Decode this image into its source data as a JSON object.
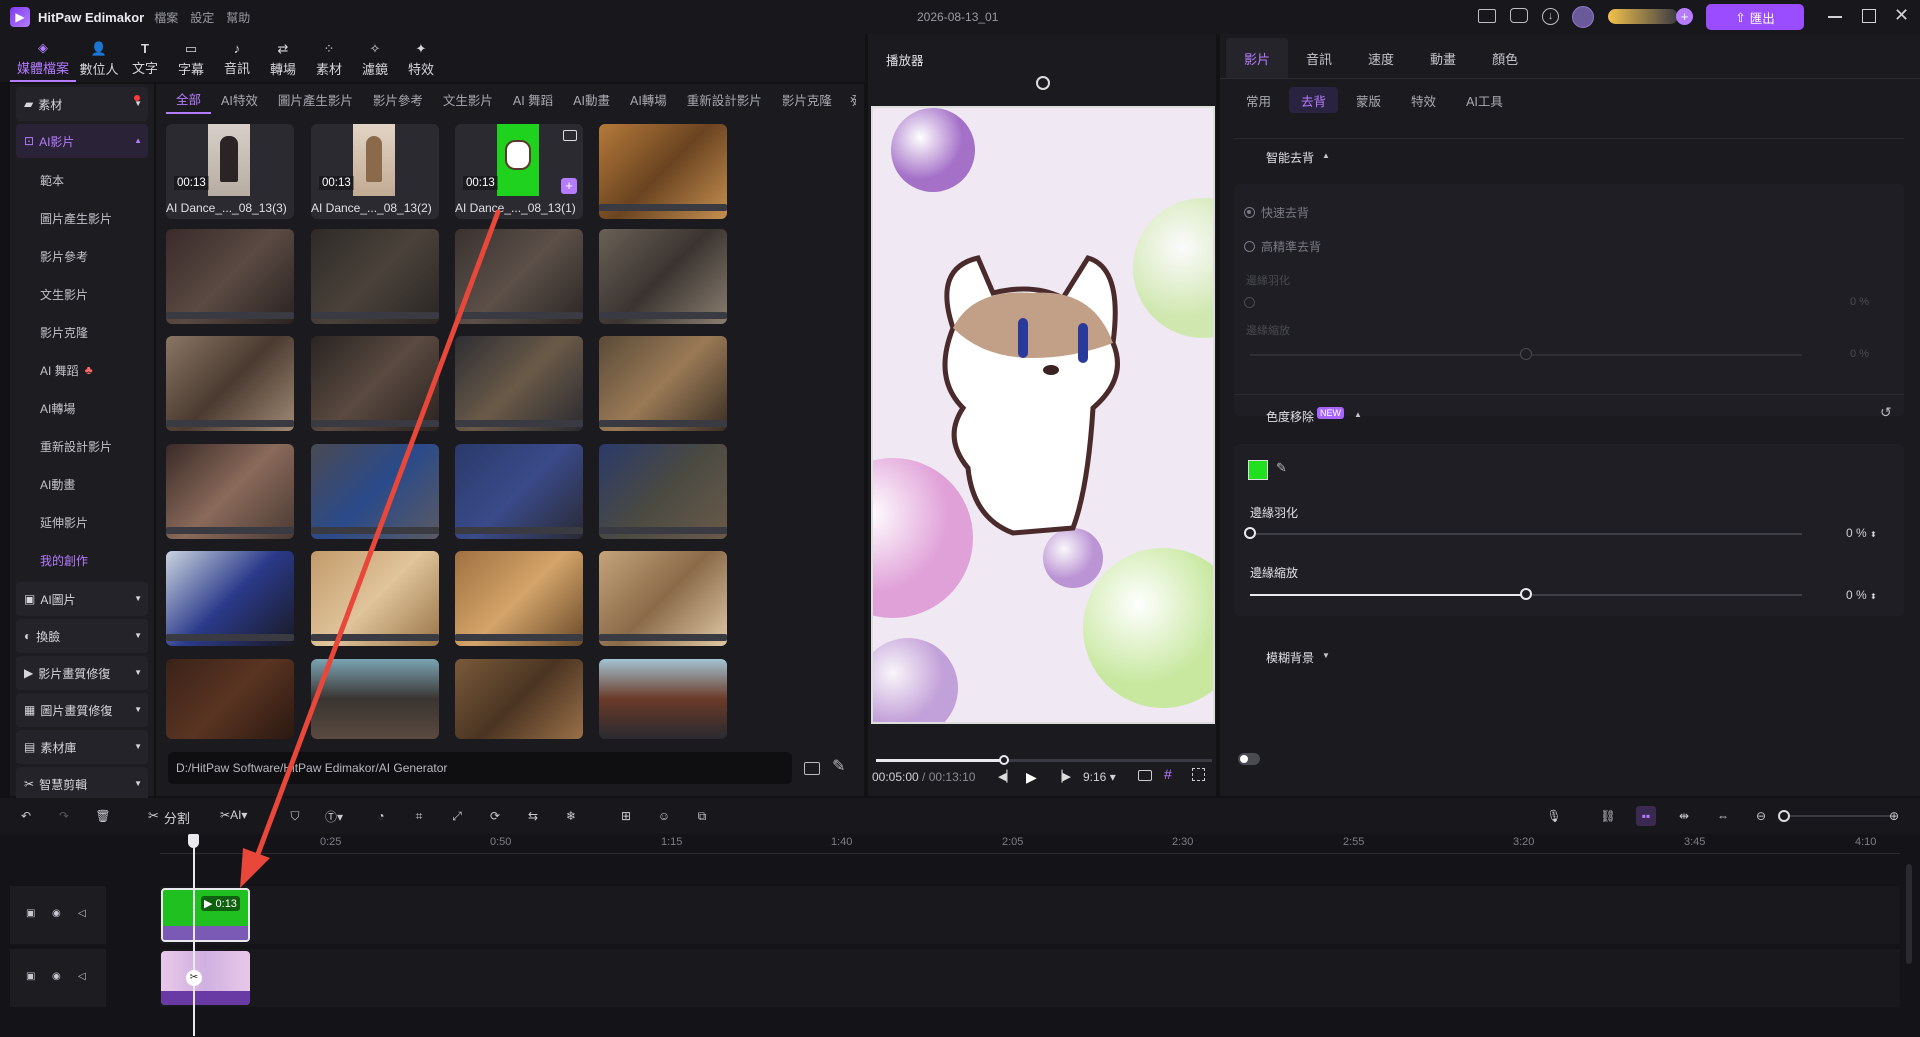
{
  "app": {
    "name": "HitPaw Edimakor",
    "menu": [
      "檔案",
      "設定",
      "幫助"
    ],
    "project_title": "2026-08-13_01",
    "export_label": "匯出"
  },
  "toolbar": {
    "tools": [
      "媒體檔案",
      "數位人",
      "文字",
      "字幕",
      "音訊",
      "轉場",
      "素材",
      "濾鏡",
      "特效"
    ]
  },
  "sidebar": {
    "sections": [
      {
        "label": "素材"
      },
      {
        "label": "AI影片",
        "items": [
          "範本",
          "圖片產生影片",
          "影片參考",
          "文生影片",
          "影片克隆",
          "AI 舞蹈",
          "AI轉場",
          "重新設計影片",
          "AI動畫",
          "延伸影片",
          "我的創作"
        ]
      },
      {
        "label": "AI圖片"
      },
      {
        "label": "換臉"
      },
      {
        "label": "影片畫質修復"
      },
      {
        "label": "圖片畫質修復"
      },
      {
        "label": "素材庫"
      },
      {
        "label": "智慧剪輯"
      }
    ]
  },
  "media": {
    "categories": [
      "全部",
      "AI特效",
      "圖片產生影片",
      "影片參考",
      "文生影片",
      "AI 舞蹈",
      "AI動畫",
      "AI轉場",
      "重新設計影片",
      "影片克隆",
      "延伸"
    ],
    "clips": [
      {
        "name": "AI Dance_..._08_13(3)",
        "duration": "00:13"
      },
      {
        "name": "AI Dance_..._08_13(2)",
        "duration": "00:13"
      },
      {
        "name": "AI Dance_..._08_13(1)",
        "duration": "00:13"
      }
    ],
    "path": "D:/HitPaw Software/HitPaw Edimakor/AI Generator"
  },
  "player": {
    "title": "播放器",
    "current_time": "00:05:00",
    "total_time": "00:13:10",
    "aspect": "9:16",
    "progress": 0.38
  },
  "right": {
    "tabs": [
      "影片",
      "音訊",
      "速度",
      "動畫",
      "顏色"
    ],
    "subtabs": [
      "常用",
      "去背",
      "蒙版",
      "特效",
      "AI工具"
    ],
    "smart_bg": {
      "label": "智能去背",
      "options": [
        "快速去背",
        "高精準去背"
      ],
      "feather_label": "邊緣羽化",
      "scale_label": "邊緣縮放",
      "feather_value": "0",
      "scale_value": "0",
      "unit": "%"
    },
    "chroma": {
      "label": "色度移除",
      "badge": "NEW",
      "color": "#20e020",
      "feather_label": "邊緣羽化",
      "feather_value": "0",
      "scale_label": "邊緣縮放",
      "scale_value": "0",
      "unit": "%",
      "feather_level": 0.0,
      "scale_level": 0.5
    },
    "blur": {
      "label": "模糊背景"
    }
  },
  "edit": {
    "split_label": "分割",
    "ai_label": "AI"
  },
  "timeline": {
    "ruler": [
      "0:25",
      "0:50",
      "1:15",
      "1:40",
      "2:05",
      "2:30",
      "2:55",
      "3:20",
      "3:45",
      "4:10"
    ],
    "clip_duration": "0:13"
  },
  "colors": {
    "accent": "#b57cff",
    "arrow": "#e8473a",
    "green": "#20e020"
  }
}
